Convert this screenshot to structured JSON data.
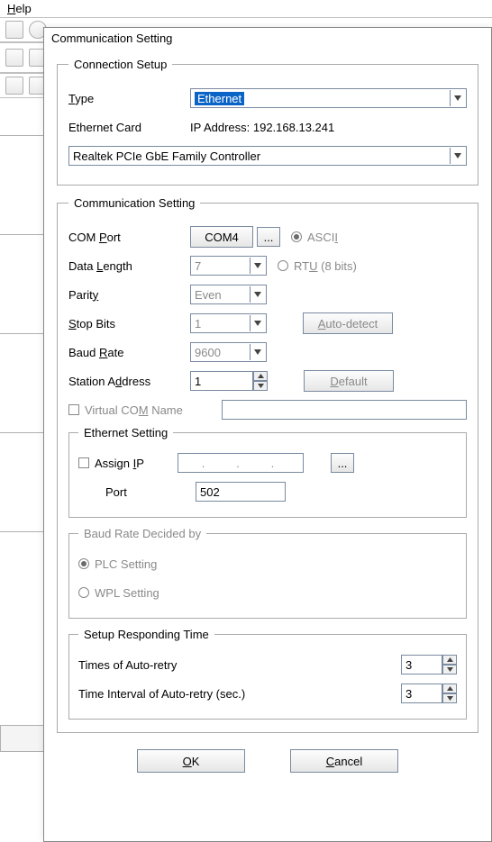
{
  "menu": {
    "help": "Help"
  },
  "dialog_title": "Communication Setting",
  "connection": {
    "legend": "Connection Setup",
    "type_label": "Type",
    "type_value": "Ethernet",
    "ethernet_card_label": "Ethernet Card",
    "ip_label": "IP Address: 192.168.13.241",
    "nic_value": "Realtek PCIe GbE Family Controller"
  },
  "comm": {
    "legend": "Communication Setting",
    "com_port_label": "COM Port",
    "com_port_value": "COM4",
    "ellipsis": "...",
    "ascii_label": "ASCII",
    "rtu_label": "RTU (8 bits)",
    "data_length_label": "Data Length",
    "data_length_value": "7",
    "parity_label": "Parity",
    "parity_value": "Even",
    "stop_bits_label": "Stop Bits",
    "stop_bits_value": "1",
    "auto_detect_label": "Auto-detect",
    "baud_rate_label": "Baud Rate",
    "baud_rate_value": "9600",
    "station_addr_label": "Station Address",
    "station_addr_value": "1",
    "default_label": "Default",
    "virtual_com_label": "Virtual COM Name",
    "virtual_com_value": ""
  },
  "eth": {
    "legend": "Ethernet Setting",
    "assign_ip_label": "Assign IP",
    "ip_value": ".   .   .",
    "ellipsis": "...",
    "port_label": "Port",
    "port_value": "502"
  },
  "baud_decided": {
    "legend": "Baud Rate Decided by",
    "plc_label": "PLC Setting",
    "wpl_label": "WPL Setting"
  },
  "responding": {
    "legend": "Setup Responding Time",
    "retry_times_label": "Times of Auto-retry",
    "retry_times_value": "3",
    "retry_interval_label": "Time Interval of Auto-retry (sec.)",
    "retry_interval_value": "3"
  },
  "buttons": {
    "ok": "OK",
    "cancel": "Cancel"
  }
}
